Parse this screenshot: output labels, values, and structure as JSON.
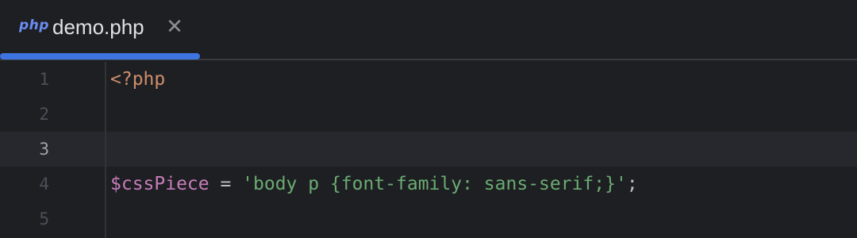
{
  "tab": {
    "icon_name": "php-file-icon",
    "icon_text": "php",
    "label": "demo.php",
    "close_glyph": "✕",
    "active": true
  },
  "editor": {
    "current_line": 3,
    "lines": [
      {
        "number": "1",
        "tokens": [
          {
            "type": "tag",
            "text": "<?php"
          }
        ]
      },
      {
        "number": "2",
        "tokens": []
      },
      {
        "number": "3",
        "tokens": []
      },
      {
        "number": "4",
        "tokens": [
          {
            "type": "var",
            "text": "$cssPiece"
          },
          {
            "type": "op",
            "text": " = "
          },
          {
            "type": "str",
            "text": "'body p {font-family: sans-serif;}'"
          },
          {
            "type": "op",
            "text": ";"
          }
        ]
      },
      {
        "number": "5",
        "tokens": []
      }
    ]
  },
  "colors": {
    "background": "#1e1f22",
    "accent": "#3e74e0",
    "keyword_tag": "#cf8e6d",
    "variable": "#c77dbb",
    "string": "#6aab73"
  }
}
